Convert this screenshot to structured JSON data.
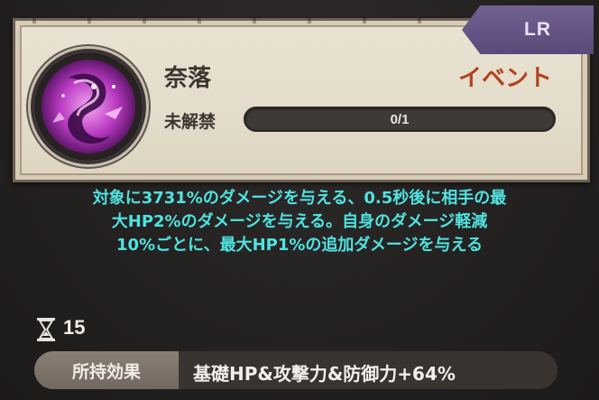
{
  "card": {
    "rarity": "LR",
    "name": "奈落",
    "category": "イベント",
    "unlock_label": "未解禁",
    "progress_text": "0/1",
    "progress_fraction": 0
  },
  "description": {
    "lines": [
      "対象に3731%のダメージを与える、0.5秒後に相手の最",
      "大HP2%のダメージを与える。自身のダメージ軽減",
      "10%ごとに、最大HP1%の追加ダメージを与える"
    ]
  },
  "cooldown": {
    "icon": "hourglass-icon",
    "value": "15"
  },
  "effect": {
    "label": "所持効果",
    "value": "基礎HP&攻撃力&防御力+64%"
  },
  "colors": {
    "rarity_badge": "#5a4a78",
    "category_text": "#b2421d",
    "description_text": "#4fe3e0",
    "avatar_accent": "#d14bd6"
  }
}
